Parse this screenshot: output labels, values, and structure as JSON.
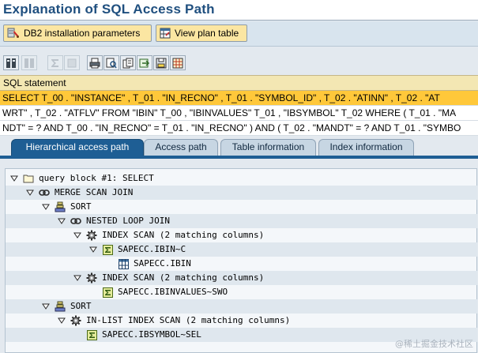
{
  "title": "Explanation of SQL Access Path",
  "app_toolbar": {
    "db2_params_label": "DB2 installation parameters",
    "db2_params_icon": "db2-settings-icon",
    "view_plan_label": "View plan table",
    "view_plan_icon": "table-view-icon"
  },
  "toolbar_icons": [
    "expand-all-icon",
    "collapse-all-icon",
    "sum-icon",
    "print-icon",
    "find-icon",
    "export-icon",
    "grid-icon"
  ],
  "sql": {
    "header": "SQL statement",
    "lines": [
      "SELECT T_00 . \"INSTANCE\" , T_01 . \"IN_RECNO\" , T_01 . \"SYMBOL_ID\" , T_02 . \"ATINN\" , T_02 . \"AT",
      "WRT\" , T_02 . \"ATFLV\" FROM \"IBIN\" T_00 , \"IBINVALUES\" T_01 , \"IBSYMBOL\" T_02 WHERE ( T_01 . \"MA",
      "NDT\" = ? AND T_00 . \"IN_RECNO\" = T_01 . \"IN_RECNO\" ) AND ( T_02 . \"MANDT\" = ? AND T_01 . \"SYMBO"
    ]
  },
  "tabs": [
    "Hierarchical access path",
    "Access path",
    "Table information",
    "Index information"
  ],
  "tree": [
    {
      "label": "query block #1: SELECT",
      "icon": "folder-icon",
      "level": 0,
      "toggle": true
    },
    {
      "label": "MERGE SCAN JOIN",
      "icon": "join-icon",
      "level": 1,
      "toggle": true
    },
    {
      "label": "SORT",
      "icon": "sort-icon",
      "level": 2,
      "toggle": true
    },
    {
      "label": "NESTED LOOP JOIN",
      "icon": "join-icon",
      "level": 3,
      "toggle": true
    },
    {
      "label": "INDEX SCAN (2 matching columns)",
      "icon": "gear-icon",
      "level": 4,
      "toggle": true
    },
    {
      "label": "SAPECC.IBIN~C",
      "icon": "sigma-index-icon",
      "level": 5,
      "toggle": true
    },
    {
      "label": "SAPECC.IBIN",
      "icon": "table-icon",
      "level": 6,
      "toggle": false
    },
    {
      "label": "INDEX SCAN (2 matching columns)",
      "icon": "gear-icon",
      "level": 4,
      "toggle": true
    },
    {
      "label": "SAPECC.IBINVALUES~SWO",
      "icon": "sigma-index-icon",
      "level": 5,
      "toggle": false
    },
    {
      "label": "SORT",
      "icon": "sort-icon",
      "level": 2,
      "toggle": true
    },
    {
      "label": "IN-LIST INDEX SCAN (2 matching columns)",
      "icon": "gear-icon",
      "level": 3,
      "toggle": true
    },
    {
      "label": "SAPECC.IBSYMBOL~SEL",
      "icon": "sigma-index-icon",
      "level": 4,
      "toggle": false
    }
  ],
  "watermark": "@稀土掘金技术社区",
  "colors": {
    "title": "#1f4f7f",
    "selected_sql_line": "#ffc83a",
    "active_tab": "#1e5e94",
    "button_bg": "#fbe6a2"
  }
}
